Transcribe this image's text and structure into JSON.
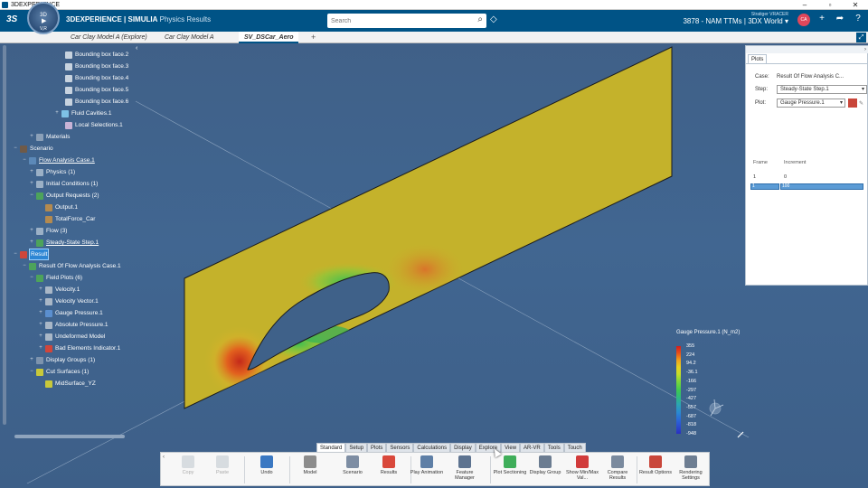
{
  "os": {
    "title": "3DEXPERIENCE",
    "controls": [
      "–",
      "▫",
      "✕"
    ]
  },
  "topbar": {
    "ds_logo": "3S",
    "compass": {
      "label": "3D",
      "version": "V,R"
    },
    "brand_main": "3DEXPERIENCE | SIMULIA",
    "brand_sub": "Physics Results",
    "search_placeholder": "Search",
    "user_small": "Stratiger VRACER",
    "user_main": "3878 - NAM TTMs | 3DX World",
    "avatar_initials": "CA"
  },
  "tabs": [
    {
      "label": "Car Clay Model A (Explore)"
    },
    {
      "label": "Car Clay Model A"
    },
    {
      "label": "SV_DSCar_Aero"
    }
  ],
  "tree": [
    {
      "label": "Bounding box face.2"
    },
    {
      "label": "Bounding box face.3"
    },
    {
      "label": "Bounding box face.4"
    },
    {
      "label": "Bounding box face.5"
    },
    {
      "label": "Bounding box face.6"
    },
    {
      "label": "Fluid Cavities.1"
    },
    {
      "label": "Local Selections.1"
    },
    {
      "label": "Materials"
    },
    {
      "label": "Scenario"
    },
    {
      "label": "Flow Analysis Case.1"
    },
    {
      "label": "Physics (1)"
    },
    {
      "label": "Initial Conditions (1)"
    },
    {
      "label": "Output Requests (2)"
    },
    {
      "label": "Output.1"
    },
    {
      "label": "TotalForce_Car"
    },
    {
      "label": "Flow (3)"
    },
    {
      "label": "Steady-State Step.1"
    },
    {
      "label": "Result"
    },
    {
      "label": "Result Of Flow Analysis Case.1"
    },
    {
      "label": "Field Plots (6)"
    },
    {
      "label": "Velocity.1"
    },
    {
      "label": "Velocity Vector.1"
    },
    {
      "label": "Gauge Pressure.1"
    },
    {
      "label": "Absolute Pressure.1"
    },
    {
      "label": "Undeformed Model"
    },
    {
      "label": "Bad Elements Indicator.1"
    },
    {
      "label": "Display Groups (1)"
    },
    {
      "label": "Cut Surfaces (1)"
    },
    {
      "label": "MidSurface_YZ"
    }
  ],
  "plots_panel": {
    "tab": "Plots",
    "case_label": "Case:",
    "case_value": "Result Of Flow Analysis C...",
    "step_label": "Step:",
    "step_value": "Steady-State Step.1",
    "plot_label": "Plot:",
    "plot_value": "Gauge Pressure.1",
    "col_frame": "Frame",
    "col_increment": "Increment",
    "row_frame": "1",
    "row_increment": "0",
    "bar_frame": "1",
    "bar_increment": "100"
  },
  "legend": {
    "title": "Gauge Pressure.1 (N_m2)",
    "values": [
      "355",
      "224",
      "94.2",
      "-36.1",
      "-166",
      "-297",
      "-427",
      "-557",
      "-687",
      "-818",
      "-948"
    ]
  },
  "ribbon_tabs": [
    "Standard",
    "Setup",
    "Plots",
    "Sensors",
    "Calculations",
    "Display",
    "Explore",
    "View",
    "AR-VR",
    "Tools",
    "Touch"
  ],
  "ribbon_buttons": [
    {
      "label": "Copy",
      "icon": "copy-icon",
      "color": "#9aa8b5",
      "disabled": true
    },
    {
      "label": "Paste",
      "icon": "paste-icon",
      "color": "#9aa8b5",
      "disabled": true
    },
    {
      "label": "Undo",
      "icon": "undo-icon",
      "color": "#3a78c2",
      "disabled": false
    },
    {
      "label": "Model",
      "icon": "model-icon",
      "color": "#8c8c8c",
      "disabled": false
    },
    {
      "label": "Scenario",
      "icon": "scenario-icon",
      "color": "#7d8da3",
      "disabled": false
    },
    {
      "label": "Results",
      "icon": "results-icon",
      "color": "#d9483b",
      "disabled": false
    },
    {
      "label": "Play Animation",
      "icon": "play-animation-icon",
      "color": "#5e7fa6",
      "disabled": false
    },
    {
      "label": "Feature Manager",
      "icon": "feature-manager-icon",
      "color": "#5d7390",
      "disabled": false
    },
    {
      "label": "Plot Sectioning",
      "icon": "plot-sectioning-icon",
      "color": "#3fae5a",
      "disabled": false
    },
    {
      "label": "Display Group",
      "icon": "display-group-icon",
      "color": "#6b7c91",
      "disabled": false
    },
    {
      "label": "Show Min/Max Val...",
      "icon": "min-max-icon",
      "color": "#d13b3b",
      "disabled": false
    },
    {
      "label": "Compare Results",
      "icon": "compare-results-icon",
      "color": "#7a8a9e",
      "disabled": false
    },
    {
      "label": "Result Options",
      "icon": "result-options-icon",
      "color": "#c9463a",
      "disabled": false
    },
    {
      "label": "Rendering Settings",
      "icon": "rendering-settings-icon",
      "color": "#6e7e92",
      "disabled": false
    }
  ]
}
